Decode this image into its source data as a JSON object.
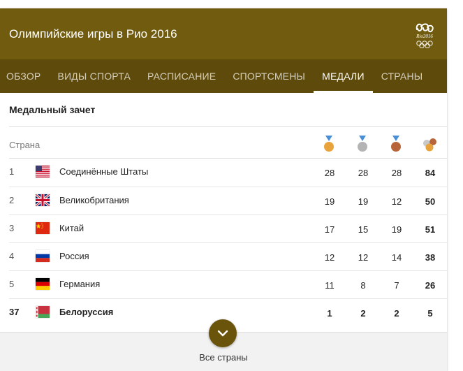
{
  "header": {
    "title": "Олимпийские игры в Рио 2016",
    "logo_text": "Rio2016",
    "background": "#715b0f"
  },
  "tabs": [
    {
      "label": "ОБЗОР",
      "active": false
    },
    {
      "label": "ВИДЫ СПОРТА",
      "active": false
    },
    {
      "label": "РАСПИСАНИЕ",
      "active": false
    },
    {
      "label": "СПОРТСМЕНЫ",
      "active": false
    },
    {
      "label": "МЕДАЛИ",
      "active": true
    },
    {
      "label": "СТРАНЫ",
      "active": false
    }
  ],
  "medal_table": {
    "title": "Медальный зачет",
    "country_column": "Страна",
    "medal_icons": [
      "gold-medal-icon",
      "silver-medal-icon",
      "bronze-medal-icon",
      "total-medals-icon"
    ],
    "colors": {
      "gold": "#e8a33d",
      "silver": "#b4b4b4",
      "bronze": "#b8643a"
    },
    "rows": [
      {
        "rank": "1",
        "country": "Соединённые Штаты",
        "flag": "us-flag-icon",
        "gold": "28",
        "silver": "28",
        "bronze": "28",
        "total": "84"
      },
      {
        "rank": "2",
        "country": "Великобритания",
        "flag": "gb-flag-icon",
        "gold": "19",
        "silver": "19",
        "bronze": "12",
        "total": "50"
      },
      {
        "rank": "3",
        "country": "Китай",
        "flag": "cn-flag-icon",
        "gold": "17",
        "silver": "15",
        "bronze": "19",
        "total": "51"
      },
      {
        "rank": "4",
        "country": "Россия",
        "flag": "ru-flag-icon",
        "gold": "12",
        "silver": "12",
        "bronze": "14",
        "total": "38"
      },
      {
        "rank": "5",
        "country": "Германия",
        "flag": "de-flag-icon",
        "gold": "11",
        "silver": "8",
        "bronze": "7",
        "total": "26"
      },
      {
        "rank": "37",
        "country": "Белоруссия",
        "flag": "by-flag-icon",
        "gold": "1",
        "silver": "2",
        "bronze": "2",
        "total": "5",
        "highlight": true
      }
    ]
  },
  "footer": {
    "all_countries_label": "Все страны"
  }
}
